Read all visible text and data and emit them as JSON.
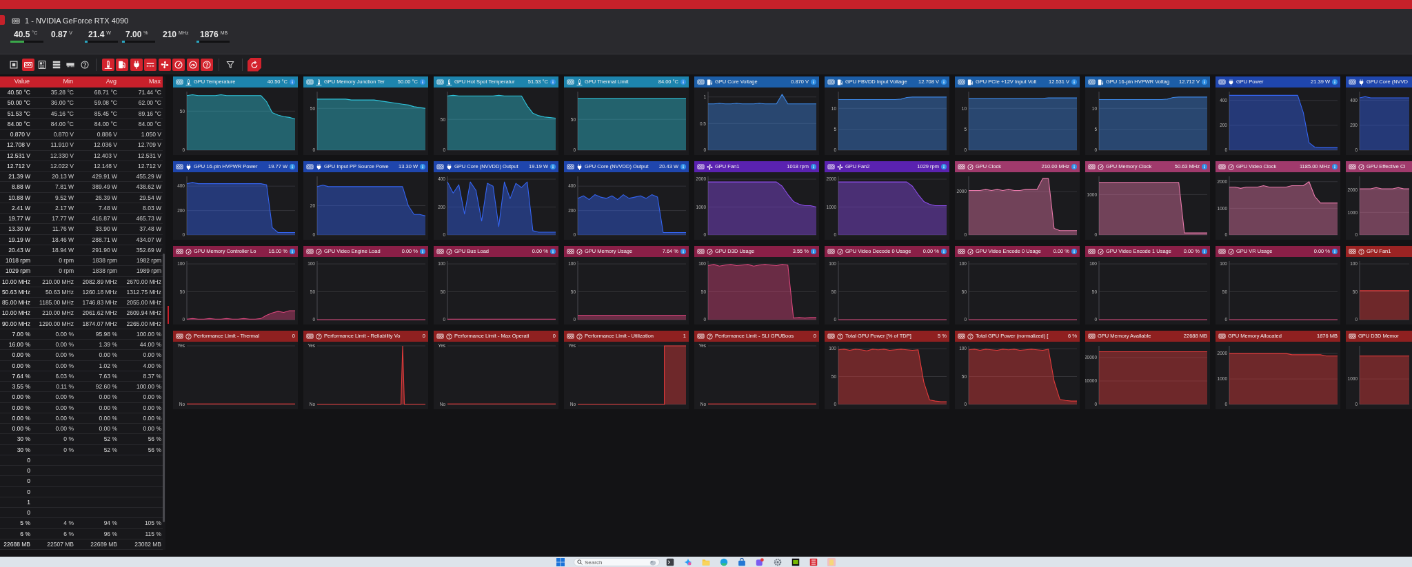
{
  "device": {
    "title": "1 - NVIDIA GeForce RTX 4090",
    "readings": [
      {
        "value": "40.5",
        "unit": "°C",
        "level": 0.42,
        "color": "#3aa84a"
      },
      {
        "value": "0.87",
        "unit": "V"
      },
      {
        "value": "21.4",
        "unit": "W",
        "level": 0.08,
        "color": "#2aa5c0"
      },
      {
        "value": "7.00",
        "unit": "%",
        "level": 0.08,
        "color": "#2aa5c0"
      },
      {
        "value": "210",
        "unit": "MHz"
      },
      {
        "value": "1876",
        "unit": "MB",
        "level": 0.08,
        "color": "#2aa5c0"
      }
    ]
  },
  "toolbar": {
    "device_buttons": [
      {
        "selected": false
      },
      {
        "selected": true
      },
      {
        "selected": false
      },
      {
        "selected": false
      },
      {
        "selected": false
      },
      {
        "selected": false
      }
    ],
    "sensor_buttons": [
      {
        "selected": true
      },
      {
        "selected": true
      },
      {
        "selected": true
      },
      {
        "selected": true
      },
      {
        "selected": true
      },
      {
        "selected": true
      },
      {
        "selected": true
      },
      {
        "selected": true
      }
    ]
  },
  "table": {
    "columns": [
      "Value",
      "Min",
      "Avg",
      "Max"
    ],
    "rows": [
      [
        "40.50 °C",
        "35.28 °C",
        "68.71 °C",
        "71.44 °C"
      ],
      [
        "50.00 °C",
        "36.00 °C",
        "59.08 °C",
        "62.00 °C"
      ],
      [
        "51.53 °C",
        "45.16 °C",
        "85.45 °C",
        "89.16 °C"
      ],
      [
        "84.00 °C",
        "84.00 °C",
        "84.00 °C",
        "84.00 °C"
      ],
      [
        "0.870 V",
        "0.870 V",
        "0.886 V",
        "1.050 V"
      ],
      [
        "12.708 V",
        "11.910 V",
        "12.036 V",
        "12.709 V"
      ],
      [
        "12.531 V",
        "12.330 V",
        "12.403 V",
        "12.531 V"
      ],
      [
        "12.712 V",
        "12.022 V",
        "12.148 V",
        "12.712 V"
      ],
      [
        "21.39 W",
        "20.13 W",
        "429.91 W",
        "455.29 W"
      ],
      [
        "8.88 W",
        "7.81 W",
        "389.49 W",
        "438.62 W"
      ],
      [
        "10.88 W",
        "9.52 W",
        "26.39 W",
        "29.54 W"
      ],
      [
        "2.41 W",
        "2.17 W",
        "7.48 W",
        "8.03 W"
      ],
      [
        "19.77 W",
        "17.77 W",
        "416.87 W",
        "465.73 W"
      ],
      [
        "13.30 W",
        "11.76 W",
        "33.90 W",
        "37.48 W"
      ],
      [
        "19.19 W",
        "18.46 W",
        "288.71 W",
        "434.07 W"
      ],
      [
        "20.43 W",
        "18.94 W",
        "291.90 W",
        "352.69 W"
      ],
      [
        "1018 rpm",
        "0 rpm",
        "1838 rpm",
        "1982 rpm"
      ],
      [
        "1029 rpm",
        "0 rpm",
        "1838 rpm",
        "1989 rpm"
      ],
      [
        "10.00 MHz",
        "210.00 MHz",
        "2082.89 MHz",
        "2670.00 MHz"
      ],
      [
        "50.63 MHz",
        "50.63 MHz",
        "1260.18 MHz",
        "1312.75 MHz"
      ],
      [
        "85.00 MHz",
        "1185.00 MHz",
        "1746.83 MHz",
        "2055.00 MHz"
      ],
      [
        "10.00 MHz",
        "210.00 MHz",
        "2061.62 MHz",
        "2609.94 MHz"
      ],
      [
        "90.00 MHz",
        "1290.00 MHz",
        "1874.07 MHz",
        "2265.00 MHz"
      ],
      [
        "7.00 %",
        "0.00 %",
        "95.98 %",
        "100.00 %"
      ],
      [
        "16.00 %",
        "0.00 %",
        "1.39 %",
        "44.00 %"
      ],
      [
        "0.00 %",
        "0.00 %",
        "0.00 %",
        "0.00 %"
      ],
      [
        "0.00 %",
        "0.00 %",
        "1.02 %",
        "4.00 %"
      ],
      [
        "7.64 %",
        "6.03 %",
        "7.63 %",
        "8.37 %"
      ],
      [
        "3.55 %",
        "0.11 %",
        "92.60 %",
        "100.00 %"
      ],
      [
        "0.00 %",
        "0.00 %",
        "0.00 %",
        "0.00 %"
      ],
      [
        "0.00 %",
        "0.00 %",
        "0.00 %",
        "0.00 %"
      ],
      [
        "0.00 %",
        "0.00 %",
        "0.00 %",
        "0.00 %"
      ],
      [
        "0.00 %",
        "0.00 %",
        "0.00 %",
        "0.00 %"
      ],
      [
        "30 %",
        "0 %",
        "52 %",
        "56 %"
      ],
      [
        "30 %",
        "0 %",
        "52 %",
        "56 %"
      ],
      [
        "0"
      ],
      [
        "0"
      ],
      [
        "0"
      ],
      [
        "0"
      ],
      [
        "1"
      ],
      [
        "0"
      ],
      [
        "5 %",
        "4 %",
        "94 %",
        "105 %"
      ],
      [
        "6 %",
        "6 %",
        "96 %",
        "115 %"
      ],
      [
        "22688 MB",
        "22507 MB",
        "22689 MB",
        "23082 MB"
      ]
    ]
  },
  "tiles": [
    {
      "name": "GPU Temperature",
      "value": "40.50 °C",
      "kind": "temperature",
      "color": "#1d84ad",
      "info": true,
      "chart_data": {
        "type": "area",
        "ylim": [
          0,
          75
        ],
        "yticks": [
          0,
          50
        ],
        "series": [
          {
            "color": "#2fc5dc",
            "values": [
              70,
              71,
              70,
              70,
              70,
              70,
              71,
              70,
              70,
              70,
              70,
              70,
              70,
              70,
              62,
              48,
              45,
              43,
              42,
              40
            ]
          }
        ]
      }
    },
    {
      "name": "GPU Memory Junction Ter",
      "value": "50.00 °C",
      "kind": "temperature",
      "color": "#1d84ad",
      "info": true,
      "chart_data": {
        "type": "area",
        "ylim": [
          0,
          70
        ],
        "yticks": [
          0,
          50
        ],
        "series": [
          {
            "color": "#2fc5dc",
            "values": [
              61,
              61,
              61,
              61,
              61,
              61,
              60,
              60,
              60,
              60,
              60,
              59,
              58,
              57,
              56,
              55,
              54,
              52,
              51,
              50
            ]
          }
        ]
      }
    },
    {
      "name": "GPU Hot Spot Temperatur",
      "value": "51.53 °C",
      "kind": "temperature",
      "color": "#1d84ad",
      "info": true,
      "chart_data": {
        "type": "area",
        "ylim": [
          0,
          95
        ],
        "yticks": [
          0,
          50
        ],
        "series": [
          {
            "color": "#2fc5dc",
            "values": [
              88,
              89,
              88,
              88,
              88,
              88,
              88,
              88,
              88,
              89,
              88,
              88,
              88,
              88,
              72,
              60,
              56,
              54,
              53,
              52
            ]
          }
        ]
      }
    },
    {
      "name": "GPU Thermal Limit",
      "value": "84.00 °C",
      "kind": "temperature",
      "color": "#1d84ad",
      "info": true,
      "chart_data": {
        "type": "area",
        "ylim": [
          0,
          95
        ],
        "yticks": [
          0,
          50
        ],
        "series": [
          {
            "color": "#2fc5dc",
            "values": [
              84,
              84,
              84,
              84,
              84,
              84,
              84,
              84,
              84,
              84,
              84,
              84,
              84,
              84,
              84,
              84,
              84,
              84,
              84,
              84
            ]
          }
        ]
      }
    },
    {
      "name": "GPU Core Voltage",
      "value": "0.870 V",
      "kind": "voltage",
      "color": "#1c5ea8",
      "info": true,
      "chart_data": {
        "type": "area",
        "ylim": [
          0,
          1.1
        ],
        "yticks": [
          0,
          0.5,
          1
        ],
        "series": [
          {
            "color": "#3d86e3",
            "values": [
              0.87,
              0.87,
              0.88,
              0.87,
              0.87,
              0.88,
              0.87,
              0.87,
              0.87,
              0.88,
              0.87,
              0.87,
              0.87,
              1.05,
              0.87,
              0.87,
              0.87,
              0.87,
              0.87,
              0.87
            ]
          }
        ]
      }
    },
    {
      "name": "GPU FBVDD Input Voltage",
      "value": "12.708 V",
      "kind": "voltage",
      "color": "#1c5ea8",
      "info": true,
      "chart_data": {
        "type": "area",
        "ylim": [
          0,
          14
        ],
        "yticks": [
          0,
          5,
          10
        ],
        "series": [
          {
            "color": "#3d86e3",
            "values": [
              12.1,
              12.1,
              12.1,
              12.1,
              12.1,
              12.1,
              12.1,
              12.1,
              12.1,
              12.1,
              12.1,
              12.2,
              12.6,
              12.7,
              12.7,
              12.7,
              12.7,
              12.7,
              12.7,
              12.7
            ]
          }
        ]
      }
    },
    {
      "name": "GPU PCIe +12V Input Volt",
      "value": "12.531 V",
      "kind": "voltage",
      "color": "#1c5ea8",
      "info": true,
      "chart_data": {
        "type": "area",
        "ylim": [
          0,
          14
        ],
        "yticks": [
          0,
          5,
          10
        ],
        "series": [
          {
            "color": "#3d86e3",
            "values": [
              12.4,
              12.4,
              12.4,
              12.4,
              12.4,
              12.4,
              12.4,
              12.4,
              12.4,
              12.4,
              12.4,
              12.4,
              12.4,
              12.4,
              12.5,
              12.5,
              12.5,
              12.5,
              12.5,
              12.5
            ]
          }
        ]
      }
    },
    {
      "name": "GPU 16-pin HVPWR Voltag",
      "value": "12.712 V",
      "kind": "voltage",
      "color": "#1c5ea8",
      "info": true,
      "chart_data": {
        "type": "area",
        "ylim": [
          0,
          14
        ],
        "yticks": [
          0,
          5,
          10
        ],
        "series": [
          {
            "color": "#3d86e3",
            "values": [
              12.1,
              12.1,
              12.1,
              12.1,
              12.1,
              12.1,
              12.1,
              12.1,
              12.1,
              12.1,
              12.1,
              12.1,
              12.2,
              12.6,
              12.7,
              12.7,
              12.7,
              12.7,
              12.7,
              12.7
            ]
          }
        ]
      }
    },
    {
      "name": "GPU Power",
      "value": "21.39 W",
      "kind": "power",
      "color": "#1f46ad",
      "info": true,
      "chart_data": {
        "type": "area",
        "ylim": [
          0,
          470
        ],
        "yticks": [
          0,
          200,
          400
        ],
        "series": [
          {
            "color": "#3565f2",
            "values": [
              440,
              440,
              440,
              440,
              440,
              440,
              440,
              440,
              440,
              440,
              440,
              440,
              440,
              300,
              60,
              25,
              20,
              20,
              20,
              20
            ]
          }
        ]
      }
    },
    {
      "name": "GPU Core (NVVD",
      "kind": "power",
      "color": "#1f46ad",
      "info": false,
      "chart_data": {
        "type": "area",
        "ylim": [
          0,
          470
        ],
        "yticks": [
          0,
          200,
          400
        ],
        "series": [
          {
            "color": "#3565f2",
            "values": [
              420,
              430,
              420,
              420,
              420,
              420,
              420,
              420,
              420,
              420
            ]
          }
        ]
      }
    },
    {
      "name": "GPU 16-pin HVPWR Power",
      "value": "19.77 W",
      "kind": "power",
      "color": "#1f46ad",
      "info": true,
      "chart_data": {
        "type": "area",
        "ylim": [
          0,
          480
        ],
        "yticks": [
          0,
          200,
          400
        ],
        "series": [
          {
            "color": "#3565f2",
            "values": [
              420,
              430,
              420,
              420,
              420,
              420,
              420,
              420,
              420,
              420,
              420,
              420,
              420,
              420,
              410,
              60,
              20,
              20,
              20,
              20
            ]
          }
        ]
      }
    },
    {
      "name": "GPU Input PP Source Powe",
      "value": "13.30 W",
      "kind": "power",
      "color": "#1f46ad",
      "info": true,
      "chart_data": {
        "type": "area",
        "ylim": [
          0,
          40
        ],
        "yticks": [
          0,
          20
        ],
        "series": [
          {
            "color": "#3565f2",
            "values": [
              33,
              34,
              33,
              33,
              33,
              33,
              33,
              33,
              33,
              33,
              33,
              33,
              33,
              33,
              33,
              33,
              20,
              14,
              14,
              13
            ]
          }
        ]
      }
    },
    {
      "name": "GPU Core (NVVDD) Output",
      "value": "19.19 W",
      "kind": "power",
      "color": "#1f46ad",
      "info": true,
      "chart_data": {
        "type": "area",
        "ylim": [
          0,
          420
        ],
        "yticks": [
          0,
          200,
          400
        ],
        "series": [
          {
            "color": "#3565f2",
            "values": [
              380,
              300,
              360,
              150,
              380,
              320,
              100,
              370,
              350,
              60,
              380,
              260,
              370,
              340,
              380,
              30,
              20,
              20,
              20,
              20
            ]
          }
        ]
      }
    },
    {
      "name": "GPU Core (NVVDD) Output",
      "value": "20.43 W",
      "kind": "power",
      "color": "#1f46ad",
      "info": true,
      "chart_data": {
        "type": "area",
        "ylim": [
          0,
          480
        ],
        "yticks": [
          0,
          200,
          400
        ],
        "series": [
          {
            "color": "#3565f2",
            "values": [
              300,
              320,
              290,
              330,
              310,
              300,
              320,
              290,
              330,
              300,
              310,
              320,
              300,
              330,
              310,
              20,
              20,
              20,
              20,
              20
            ]
          }
        ]
      }
    },
    {
      "name": "GPU Fan1",
      "value": "1018 rpm",
      "kind": "fan",
      "color": "#5a22b0",
      "info": true,
      "chart_data": {
        "type": "area",
        "ylim": [
          0,
          2100
        ],
        "yticks": [
          0,
          1000,
          2000
        ],
        "series": [
          {
            "color": "#8d4deb",
            "values": [
              1900,
              1900,
              1900,
              1900,
              1900,
              1900,
              1900,
              1900,
              1900,
              1900,
              1900,
              1900,
              1900,
              1750,
              1450,
              1200,
              1100,
              1050,
              1050,
              1000
            ]
          }
        ]
      }
    },
    {
      "name": "GPU Fan2",
      "value": "1029 rpm",
      "kind": "fan",
      "color": "#5a22b0",
      "info": true,
      "chart_data": {
        "type": "area",
        "ylim": [
          0,
          2100
        ],
        "yticks": [
          0,
          1000,
          2000
        ],
        "series": [
          {
            "color": "#8d4deb",
            "values": [
              1900,
              1900,
              1900,
              1900,
              1900,
              1900,
              1900,
              1900,
              1900,
              1900,
              1900,
              1900,
              1900,
              1750,
              1450,
              1200,
              1100,
              1050,
              1050,
              1050
            ]
          }
        ]
      }
    },
    {
      "name": "GPU Clock",
      "value": "210.00 MHz",
      "kind": "clock",
      "color": "#a03a6c",
      "info": true,
      "chart_data": {
        "type": "area",
        "ylim": [
          0,
          2700
        ],
        "yticks": [
          0,
          2000
        ],
        "series": [
          {
            "color": "#e97aab",
            "values": [
              2050,
              2050,
              2050,
              2100,
              2050,
              2100,
              2050,
              2100,
              2050,
              2050,
              2100,
              2100,
              2100,
              2600,
              2600,
              300,
              200,
              200,
              200,
              200
            ]
          }
        ]
      }
    },
    {
      "name": "GPU Memory Clock",
      "value": "50.63 MHz",
      "kind": "clock",
      "color": "#a03a6c",
      "info": true,
      "chart_data": {
        "type": "area",
        "ylim": [
          0,
          1450
        ],
        "yticks": [
          0,
          1000
        ],
        "series": [
          {
            "color": "#e97aab",
            "values": [
              1300,
              1300,
              1300,
              1300,
              1300,
              1300,
              1300,
              1300,
              1300,
              1300,
              1300,
              1300,
              1300,
              1300,
              1300,
              50,
              50,
              50,
              50,
              50
            ]
          }
        ]
      }
    },
    {
      "name": "GPU Video Clock",
      "value": "1185.00 MHz",
      "kind": "clock",
      "color": "#a03a6c",
      "info": true,
      "chart_data": {
        "type": "area",
        "ylim": [
          0,
          2200
        ],
        "yticks": [
          0,
          1000,
          2000
        ],
        "series": [
          {
            "color": "#e97aab",
            "values": [
              1800,
              1800,
              1750,
              1800,
              1800,
              1800,
              1850,
              1800,
              1800,
              1800,
              1800,
              1850,
              1850,
              1850,
              2000,
              1450,
              1200,
              1200,
              1200,
              1200
            ]
          }
        ]
      }
    },
    {
      "name": "GPU Effective Cl",
      "kind": "clock",
      "color": "#a03a6c",
      "info": false,
      "chart_data": {
        "type": "area",
        "ylim": [
          0,
          2600
        ],
        "yticks": [
          0,
          1000,
          2000
        ],
        "series": [
          {
            "color": "#e97aab",
            "values": [
              2050,
              2050,
              2050,
              2100,
              2050,
              2050,
              2050,
              2100,
              2050,
              2050
            ]
          }
        ]
      }
    },
    {
      "name": "GPU Memory Controller Lo",
      "value": "16.00 %",
      "kind": "usage",
      "color": "#8a1f47",
      "info": true,
      "chart_data": {
        "type": "area",
        "ylim": [
          0,
          105
        ],
        "yticks": [
          0,
          50,
          100
        ],
        "series": [
          {
            "color": "#d8467b",
            "values": [
              1,
              2,
              1,
              1,
              2,
              1,
              1,
              2,
              1,
              1,
              2,
              1,
              1,
              2,
              8,
              12,
              15,
              13,
              16,
              16
            ]
          }
        ]
      }
    },
    {
      "name": "GPU Video Engine Load",
      "value": "0.00 %",
      "kind": "usage",
      "color": "#8a1f47",
      "info": true,
      "chart_data": {
        "type": "line",
        "ylim": [
          0,
          105
        ],
        "yticks": [
          0,
          50,
          100
        ],
        "series": [
          {
            "color": "#d8467b",
            "values": [
              0,
              0,
              0,
              0,
              0,
              0,
              0,
              0,
              0,
              0,
              0,
              0,
              0,
              0,
              0,
              0,
              0,
              0,
              0,
              0
            ]
          }
        ]
      }
    },
    {
      "name": "GPU Bus Load",
      "value": "0.00 %",
      "kind": "usage",
      "color": "#8a1f47",
      "info": true,
      "chart_data": {
        "type": "area",
        "ylim": [
          0,
          105
        ],
        "yticks": [
          0,
          50,
          100
        ],
        "series": [
          {
            "color": "#d8467b",
            "values": [
              1,
              1,
              1,
              1,
              1,
              1,
              1,
              1,
              1,
              1,
              1,
              1,
              1,
              1,
              1,
              1,
              1,
              1,
              1,
              1
            ]
          }
        ]
      }
    },
    {
      "name": "GPU Memory Usage",
      "value": "7.64 %",
      "kind": "usage",
      "color": "#8a1f47",
      "info": true,
      "chart_data": {
        "type": "area",
        "ylim": [
          0,
          105
        ],
        "yticks": [
          0,
          50,
          100
        ],
        "series": [
          {
            "color": "#d8467b",
            "values": [
              8,
              8,
              8,
              8,
              8,
              8,
              8,
              8,
              8,
              8,
              8,
              8,
              8,
              8,
              8,
              8,
              8,
              8,
              8,
              8
            ]
          }
        ]
      }
    },
    {
      "name": "GPU D3D Usage",
      "value": "3.55 %",
      "kind": "usage",
      "color": "#8a1f47",
      "info": true,
      "chart_data": {
        "type": "area",
        "ylim": [
          0,
          105
        ],
        "yticks": [
          0,
          50,
          100
        ],
        "series": [
          {
            "color": "#d8467b",
            "values": [
              97,
              99,
              96,
              98,
              99,
              97,
              98,
              99,
              96,
              98,
              99,
              98,
              97,
              99,
              98,
              3,
              4,
              3,
              4,
              4
            ]
          }
        ]
      }
    },
    {
      "name": "GPU Video Decode 0 Usage",
      "value": "0.00 %",
      "kind": "usage",
      "color": "#8a1f47",
      "info": true,
      "chart_data": {
        "type": "line",
        "ylim": [
          0,
          105
        ],
        "yticks": [
          0,
          50,
          100
        ],
        "series": [
          {
            "color": "#d8467b",
            "values": [
              0,
              0,
              0,
              0,
              0,
              0,
              0,
              0,
              0,
              0,
              0,
              0,
              0,
              0,
              0,
              0,
              0,
              0,
              0,
              0
            ]
          }
        ]
      }
    },
    {
      "name": "GPU Video Encode 0 Usage",
      "value": "0.00 %",
      "kind": "usage",
      "color": "#8a1f47",
      "info": true,
      "chart_data": {
        "type": "line",
        "ylim": [
          0,
          105
        ],
        "yticks": [
          0,
          50,
          100
        ],
        "series": [
          {
            "color": "#d8467b",
            "values": [
              0,
              0,
              0,
              0,
              0,
              0,
              0,
              0,
              0,
              0,
              0,
              0,
              0,
              0,
              0,
              0,
              0,
              0,
              0,
              0
            ]
          }
        ]
      }
    },
    {
      "name": "GPU Video Encode 1 Usage",
      "value": "0.00 %",
      "kind": "usage",
      "color": "#8a1f47",
      "info": true,
      "chart_data": {
        "type": "line",
        "ylim": [
          0,
          105
        ],
        "yticks": [
          0,
          50,
          100
        ],
        "series": [
          {
            "color": "#d8467b",
            "values": [
              0,
              0,
              0,
              0,
              0,
              0,
              0,
              0,
              0,
              0,
              0,
              0,
              0,
              0,
              0,
              0,
              0,
              0,
              0,
              0
            ]
          }
        ]
      }
    },
    {
      "name": "GPU VR Usage",
      "value": "0.00 %",
      "kind": "usage",
      "color": "#8a1f47",
      "info": true,
      "chart_data": {
        "type": "line",
        "ylim": [
          0,
          105
        ],
        "yticks": [
          0,
          50,
          100
        ],
        "series": [
          {
            "color": "#d8467b",
            "values": [
              0,
              0,
              0,
              0,
              0,
              0,
              0,
              0,
              0,
              0,
              0,
              0,
              0,
              0,
              0,
              0,
              0,
              0,
              0,
              0
            ]
          }
        ]
      }
    },
    {
      "name": "GPU Fan1",
      "kind": "other",
      "color": "#9b2323",
      "info": false,
      "chart_data": {
        "type": "area",
        "ylim": [
          0,
          105
        ],
        "yticks": [
          0,
          50,
          100
        ],
        "series": [
          {
            "color": "#e23b3b",
            "values": [
              52,
              52,
              52,
              52,
              52,
              52,
              52,
              52,
              52,
              52
            ]
          }
        ]
      }
    },
    {
      "name": "Performance Limit - Thermal",
      "value": "0",
      "kind": "other",
      "color": "#8f2020",
      "info": false,
      "trace": {
        "kind": "flat",
        "labels": [
          "Yes",
          "No"
        ]
      }
    },
    {
      "name": "Performance Limit - Reliability Vo",
      "value": "0",
      "kind": "other",
      "color": "#8f2020",
      "info": false,
      "trace": {
        "kind": "spike",
        "labels": [
          "Yes",
          "No"
        ]
      }
    },
    {
      "name": "Performance Limit - Max Operati",
      "value": "0",
      "kind": "other",
      "color": "#8f2020",
      "info": false,
      "trace": {
        "kind": "flat",
        "labels": [
          "Yes",
          "No"
        ]
      }
    },
    {
      "name": "Performance Limit - Utilization",
      "value": "1",
      "kind": "other",
      "color": "#8f2020",
      "info": false,
      "trace": {
        "kind": "step",
        "labels": [
          "Yes",
          "No"
        ]
      }
    },
    {
      "name": "Performance Limit - SLI GPUBoos",
      "value": "0",
      "kind": "other",
      "color": "#8f2020",
      "info": false,
      "trace": {
        "kind": "flat",
        "labels": [
          "Yes",
          "No"
        ]
      }
    },
    {
      "name": "Total GPU Power [% of TDP]",
      "value": "5 %",
      "kind": "other",
      "color": "#8f2020",
      "info": false,
      "chart_data": {
        "type": "area",
        "ylim": [
          0,
          105
        ],
        "yticks": [
          0,
          50,
          100
        ],
        "series": [
          {
            "color": "#e23b3b",
            "values": [
              98,
              99,
              97,
              99,
              98,
              96,
              99,
              98,
              99,
              97,
              98,
              99,
              98,
              97,
              98,
              40,
              8,
              6,
              5,
              5
            ]
          }
        ]
      }
    },
    {
      "name": "Total GPU Power (normalized) [",
      "value": "6 %",
      "kind": "other",
      "color": "#8f2020",
      "info": false,
      "chart_data": {
        "type": "area",
        "ylim": [
          0,
          105
        ],
        "yticks": [
          0,
          50,
          100
        ],
        "series": [
          {
            "color": "#e23b3b",
            "values": [
              98,
              99,
              97,
              99,
              98,
              97,
              99,
              98,
              99,
              97,
              98,
              99,
              98,
              97,
              99,
              42,
              9,
              7,
              6,
              6
            ]
          }
        ]
      }
    },
    {
      "name": "GPU Memory Available",
      "value": "22688 MB",
      "kind": "memory",
      "color": "#8f2020",
      "info": false,
      "chart_data": {
        "type": "area",
        "ylim": [
          0,
          25000
        ],
        "yticks": [
          0,
          10000,
          20000
        ],
        "series": [
          {
            "color": "#e23b3b",
            "values": [
              22500,
              22500,
              22500,
              22500,
              22500,
              22500,
              22500,
              22500,
              22500,
              22500,
              22500,
              22500,
              22500,
              22500,
              22500,
              22500,
              22500,
              22500,
              22500,
              22500
            ]
          }
        ]
      }
    },
    {
      "name": "GPU Memory Allocated",
      "value": "1876 MB",
      "kind": "memory",
      "color": "#8f2020",
      "info": false,
      "chart_data": {
        "type": "area",
        "ylim": [
          0,
          2300
        ],
        "yticks": [
          0,
          1000,
          2000
        ],
        "series": [
          {
            "color": "#e23b3b",
            "values": [
              2000,
              2000,
              2000,
              2000,
              2000,
              2000,
              2000,
              2000,
              2000,
              2000,
              2000,
              1950,
              1950,
              1950,
              1950,
              1950,
              1950,
              1900,
              1900,
              1900
            ]
          }
        ]
      }
    },
    {
      "name": "GPU D3D Memor",
      "kind": "memory",
      "color": "#8f2020",
      "info": false,
      "chart_data": {
        "type": "area",
        "ylim": [
          0,
          2300
        ],
        "yticks": [
          0,
          1000
        ],
        "series": [
          {
            "color": "#e23b3b",
            "values": [
              1900,
              1900,
              1900,
              1900,
              1900,
              1900,
              1900,
              1900,
              1900,
              1900
            ]
          }
        ]
      }
    }
  ],
  "taskbar": {
    "search": {
      "placeholder": "Search"
    }
  }
}
